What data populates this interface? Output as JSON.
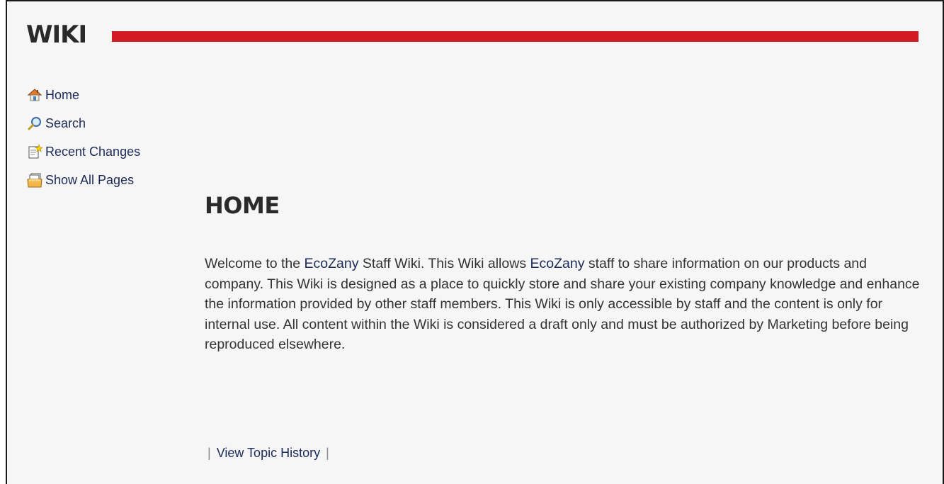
{
  "header": {
    "title": "WIKI",
    "accent_color": "#d11a22"
  },
  "nav": {
    "items": [
      {
        "label": "Home",
        "icon": "home-icon"
      },
      {
        "label": "Search",
        "icon": "search-icon"
      },
      {
        "label": "Recent Changes",
        "icon": "recent-changes-icon"
      },
      {
        "label": "Show All Pages",
        "icon": "show-all-pages-icon"
      }
    ]
  },
  "page": {
    "heading": "HOME",
    "body": {
      "part1": "Welcome to the ",
      "link1": "EcoZany",
      "part2": " Staff Wiki. This Wiki allows ",
      "link2": "EcoZany",
      "part3": " staff to share information on our products and company. This Wiki is designed as a place to quickly store and share your existing company knowledge and enhance the information provided by other staff members. This Wiki is only accessible by staff and the content is only for internal use. All content within the Wiki is considered a draft only and must be authorized by Marketing before being reproduced elsewhere."
    },
    "footer": {
      "separator": "|",
      "history_link": "View Topic History"
    }
  }
}
